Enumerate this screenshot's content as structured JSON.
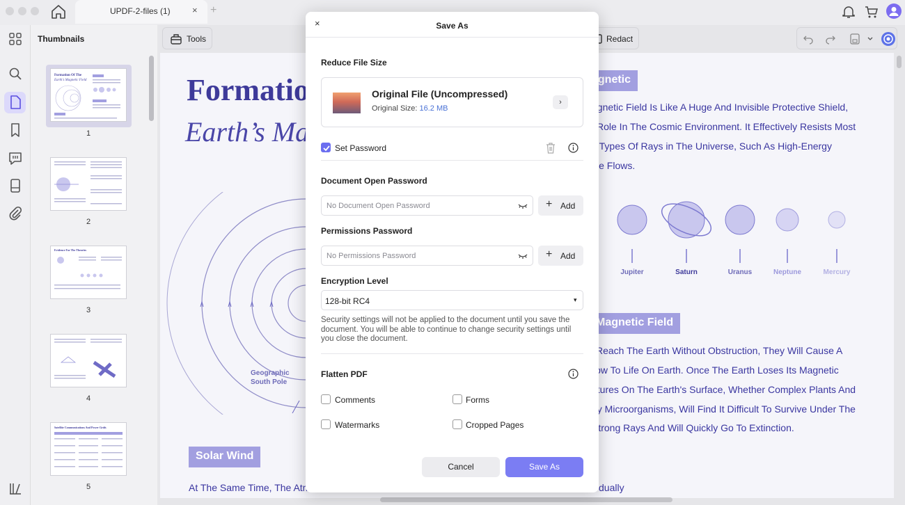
{
  "topbar": {
    "tab_title": "UPDF-2-files (1)",
    "tab_close": "×",
    "tab_add": "+",
    "icons": [
      "home-icon",
      "bell-icon",
      "cart-icon",
      "user-avatar-icon"
    ]
  },
  "thumbnails": {
    "title": "Thumbnails",
    "pages": [
      "1",
      "2",
      "3",
      "4",
      "5"
    ],
    "selected_page": "1"
  },
  "toolbar": {
    "tools_label": "Tools",
    "redact_label": "Redact"
  },
  "document": {
    "title_line1": "Formatio",
    "title_line2": "Earth’s Ma",
    "heading_magnetic": "agnetic",
    "para1": [
      "agnetic Field Is Like A Huge And Invisible Protective Shield,",
      "l Role In The Cosmic Environment. It Effectively Resists Most",
      "s Types Of Rays in The Universe, Such As High-Energy",
      "cle Flows."
    ],
    "planets": [
      "Jupiter",
      "Saturn",
      "Uranus",
      "Neptune",
      "Mercury"
    ],
    "heading_magnetic_field": "Magnetic Field",
    "para2": [
      "Reach The Earth Without Obstruction, They Will Cause A",
      "low To Life On Earth. Once The Earth Loses Its Magnetic",
      "atures On The Earth's Surface, Whether Complex Plants And",
      "ny Microorganisms, Will Find It Difficult To Survive Under The",
      "Strong Rays And Will Quickly Go To Extinction."
    ],
    "geo_label_1": "Geographic",
    "geo_label_2": "South Pole",
    "heading_solar_wind": "Solar Wind",
    "bottom_left_text": "At The Same Time, The Atmo",
    "bottom_right_text": "dually"
  },
  "dialog": {
    "title": "Save As",
    "close": "×",
    "reduce_label": "Reduce File Size",
    "file_name": "Original File (Uncompressed)",
    "size_label": "Original Size:",
    "size_value": "16.2 MB",
    "file_arrow": "›",
    "set_password_label": "Set Password",
    "set_password_checked": true,
    "open_pw_label": "Document Open Password",
    "open_pw_placeholder": "No Document Open Password",
    "permissions_label": "Permissions Password",
    "permissions_placeholder": "No Permissions Password",
    "add_label": "Add",
    "add_plus": "+",
    "encryption_label": "Encryption Level",
    "encryption_value": "128-bit RC4",
    "encryption_caret": "▾",
    "note": "Security settings will not be applied to the document until you save the document. You will be able to continue to change security settings until you close the document.",
    "flatten_label": "Flatten PDF",
    "flatten_options": [
      "Comments",
      "Forms",
      "Watermarks",
      "Cropped Pages"
    ],
    "cancel_label": "Cancel",
    "save_label": "Save As",
    "accent_color": "#7b7df3"
  }
}
